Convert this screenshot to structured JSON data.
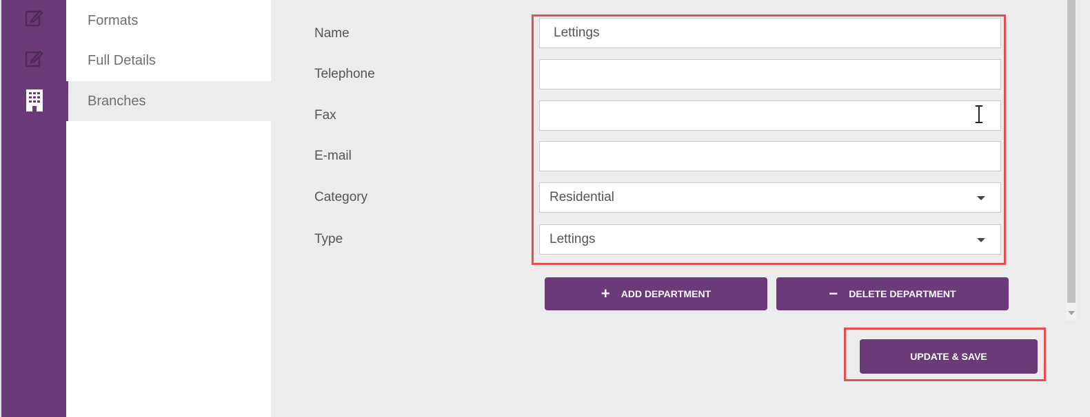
{
  "rail": {
    "items": [
      {
        "icon": "edit-icon"
      },
      {
        "icon": "edit-icon"
      },
      {
        "icon": "building-icon",
        "active": true
      }
    ]
  },
  "subnav": {
    "items": [
      {
        "label": "Formats"
      },
      {
        "label": "Full Details"
      },
      {
        "label": "Branches",
        "active": true
      }
    ]
  },
  "form": {
    "name": {
      "label": "Name",
      "value": "Lettings"
    },
    "telephone": {
      "label": "Telephone",
      "value": ""
    },
    "fax": {
      "label": "Fax",
      "value": ""
    },
    "email": {
      "label": "E-mail",
      "value": ""
    },
    "category": {
      "label": "Category",
      "value": "Residential"
    },
    "type": {
      "label": "Type",
      "value": "Lettings"
    }
  },
  "buttons": {
    "add_department": "ADD DEPARTMENT",
    "delete_department": "DELETE DEPARTMENT",
    "update_save": "UPDATE & SAVE"
  },
  "colors": {
    "accent": "#6a3a79",
    "highlight": "#e84c4c",
    "background": "#ececec"
  }
}
